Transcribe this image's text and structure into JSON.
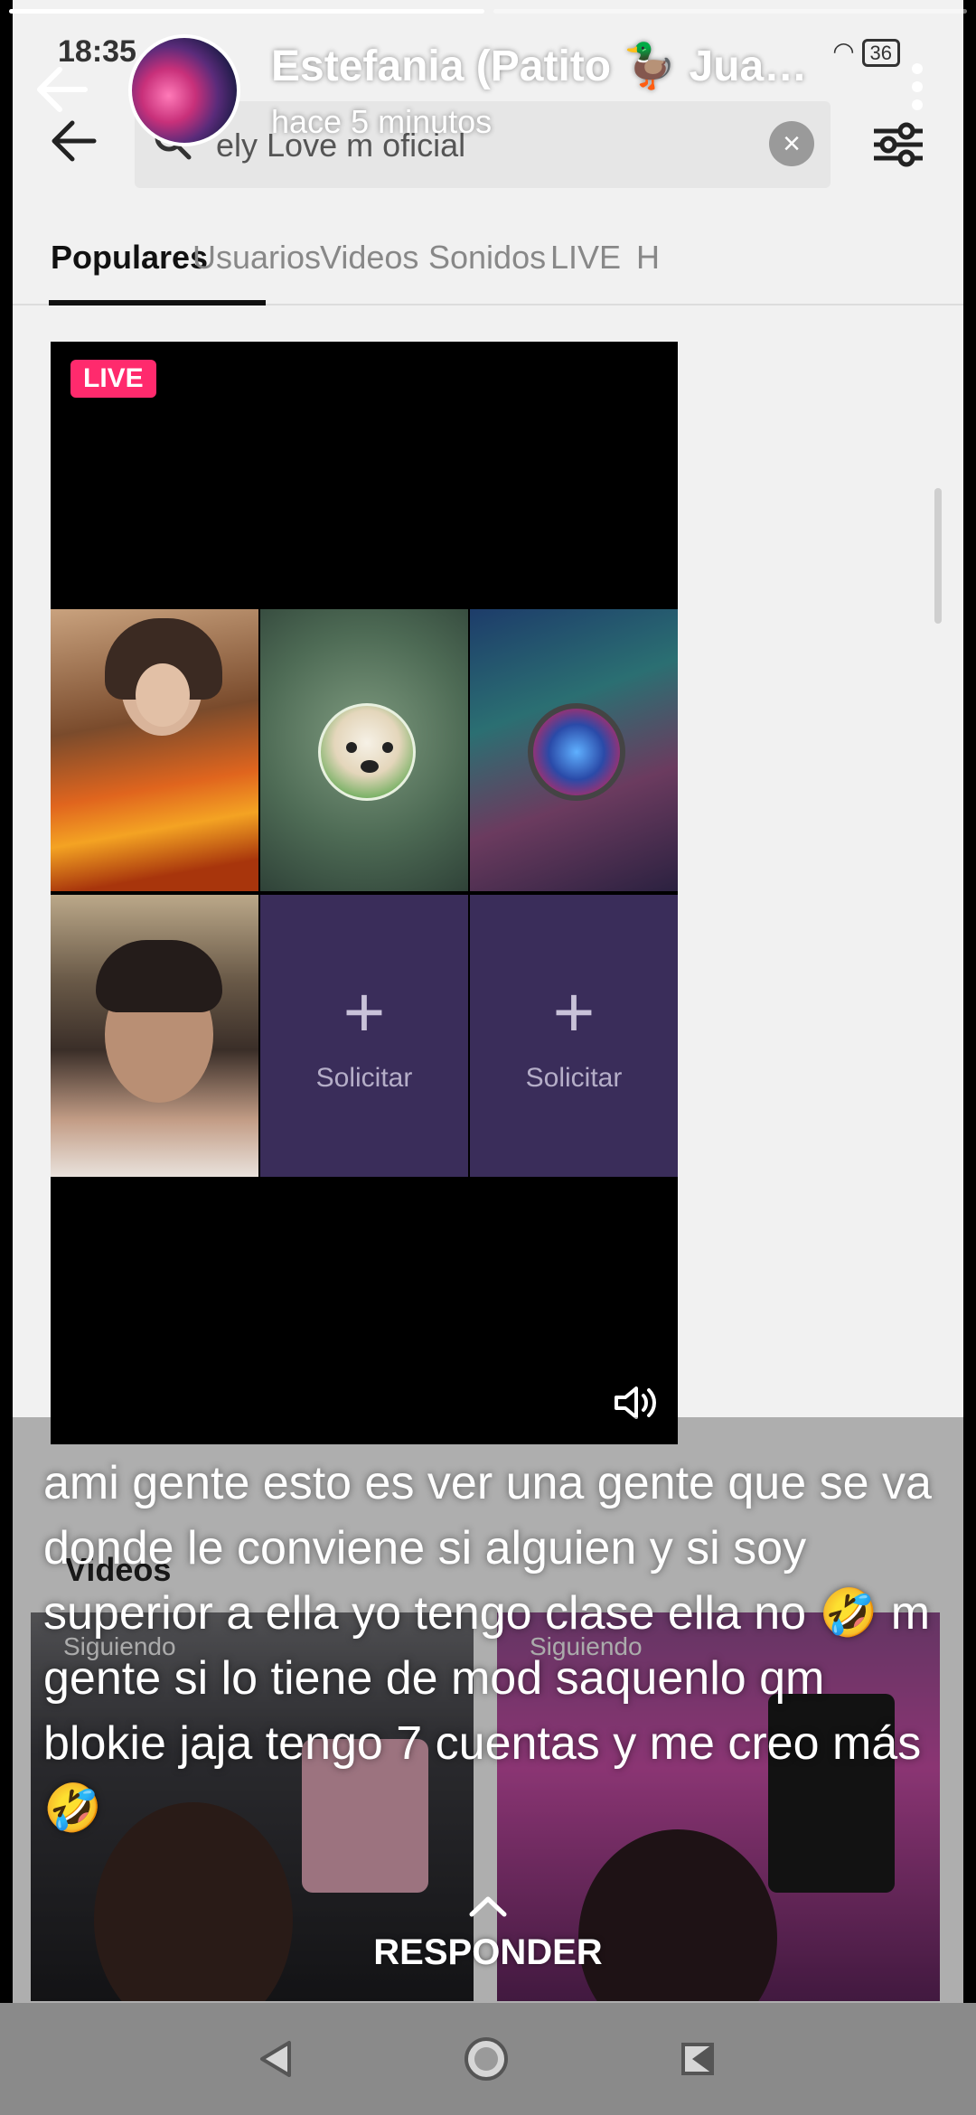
{
  "story": {
    "username": "Estefania (Patito 🦆 Jua…",
    "timestamp": "hace 5 minutos",
    "caption": "ami gente esto es ver una gente que se va donde le conviene si alguien y si soy superior a ella yo tengo clase ella no 🤣 m gente si lo tiene de mod saquenlo qm blokie jaja tengo 7 cuentas y me creo más🤣",
    "reply_label": "RESPONDER"
  },
  "screenshot": {
    "status_time": "18:35",
    "battery": "36",
    "search_text": "ely Love m oficial",
    "tabs": [
      "Populares",
      "Usuarios",
      "Videos",
      "Sonidos",
      "LIVE",
      "H"
    ],
    "active_tab": "Populares",
    "live_badge": "LIVE",
    "request_label": "Solicitar",
    "videos_label": "Videos",
    "following_label": "Siguiendo"
  },
  "icons": {
    "back": "back-arrow-icon",
    "more": "more-vertical-icon",
    "reply": "chevron-up-icon",
    "nav": [
      "back-triangle-icon",
      "home-circle-icon",
      "recents-square-icon"
    ]
  }
}
